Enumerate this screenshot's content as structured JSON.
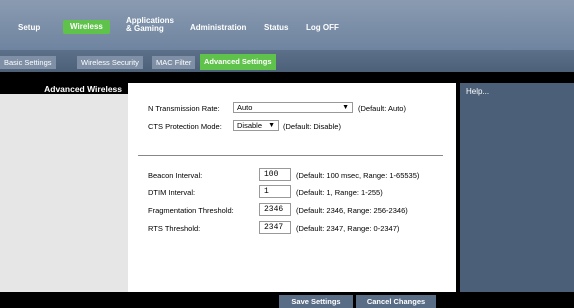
{
  "menu": {
    "setup": "Setup",
    "wireless": "Wireless",
    "applications_gaming_line1": "Applications",
    "applications_gaming_line2": "& Gaming",
    "administration": "Administration",
    "status": "Status",
    "logoff": "Log OFF"
  },
  "subtabs": {
    "basic": "Basic Settings",
    "security": "Wireless Security",
    "mac": "MAC Filter",
    "advanced": "Advanced Settings"
  },
  "section": {
    "title": "Advanced Wireless"
  },
  "settings": {
    "n_rate": {
      "label": "N Transmission Rate:",
      "value": "Auto",
      "hint": "(Default: Auto)"
    },
    "cts": {
      "label": "CTS Protection Mode:",
      "value": "Disable",
      "hint": "(Default: Disable)"
    },
    "beacon": {
      "label": "Beacon Interval:",
      "value": "100",
      "hint": "(Default: 100 msec, Range: 1-65535)"
    },
    "dtim": {
      "label": "DTIM Interval:",
      "value": "1",
      "hint": "(Default: 1, Range: 1-255)"
    },
    "frag": {
      "label": "Fragmentation Threshold:",
      "value": "2346",
      "hint": "(Default: 2346, Range: 256-2346)"
    },
    "rts": {
      "label": "RTS Threshold:",
      "value": "2347",
      "hint": "(Default: 2347, Range: 0-2347)"
    }
  },
  "help": {
    "text": "Help..."
  },
  "buttons": {
    "save": "Save Settings",
    "cancel": "Cancel Changes"
  },
  "colors": {
    "accent": "#5fc24a",
    "nav": "#6f84a0",
    "help_bg": "#4b5f78"
  }
}
